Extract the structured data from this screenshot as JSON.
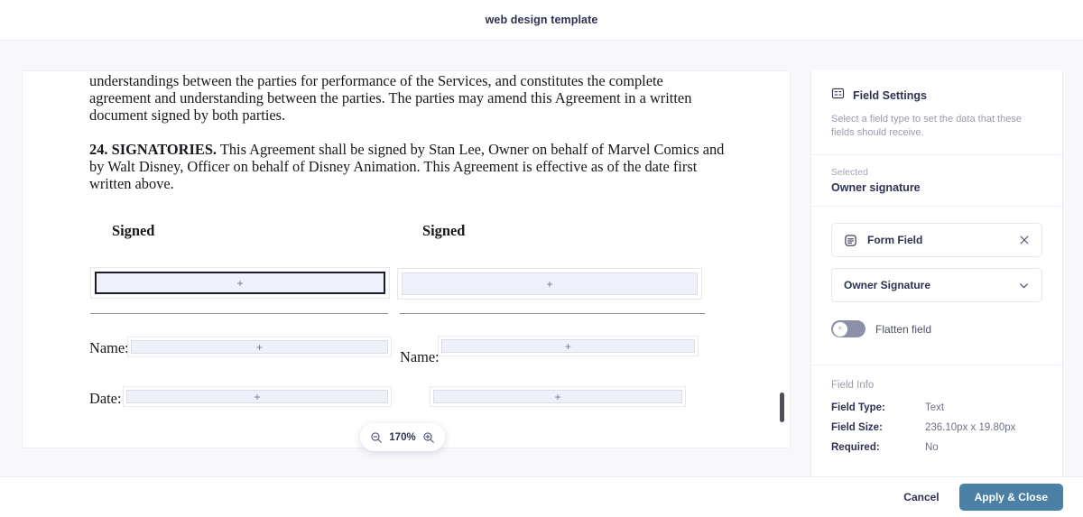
{
  "header": {
    "title": "web design template"
  },
  "document": {
    "paragraph_1": "understandings between the parties for performance of the Services, and constitutes the complete agreement and understanding between the parties. The parties may amend this Agreement in a written document signed by both parties.",
    "clause_number": "24. SIGNATORIES.",
    "paragraph_2": " This Agreement shall be signed by Stan Lee, Owner on behalf of Marvel Comics and by Walt Disney, Officer on behalf of Disney Animation. This Agreement is effective as of the date first written above.",
    "signed_label_left": "Signed",
    "signed_label_right": "Signed",
    "name_label_left": "Name:",
    "name_label_right": "Name:",
    "date_label_left": "Date:",
    "field_placeholder": "+"
  },
  "zoom_control": {
    "zoom_out_icon": "magnifier-minus-icon",
    "level": "170%",
    "zoom_in_icon": "magnifier-plus-icon"
  },
  "panel": {
    "icon": "form-settings-icon",
    "title": "Field Settings",
    "description": "Select a field type to set the data that these fields should receive.",
    "selected_label": "Selected",
    "selected_value": "Owner signature",
    "field_card": {
      "icon": "form-field-icon",
      "label": "Form Field",
      "close_icon": "close-icon"
    },
    "type_select": {
      "value": "Owner Signature",
      "chevron_icon": "chevron-down-icon"
    },
    "toggle": {
      "label": "Flatten field",
      "state": "off",
      "knob_glyph": "×"
    },
    "field_info": {
      "title": "Field Info",
      "rows": [
        {
          "key": "Field Type:",
          "value": "Text"
        },
        {
          "key": "Field Size:",
          "value": "236.10px x 19.80px"
        },
        {
          "key": "Required:",
          "value": "No"
        }
      ]
    }
  },
  "footer": {
    "cancel_label": "Cancel",
    "apply_label": "Apply & Close",
    "apply_color": "#4a80a5"
  }
}
